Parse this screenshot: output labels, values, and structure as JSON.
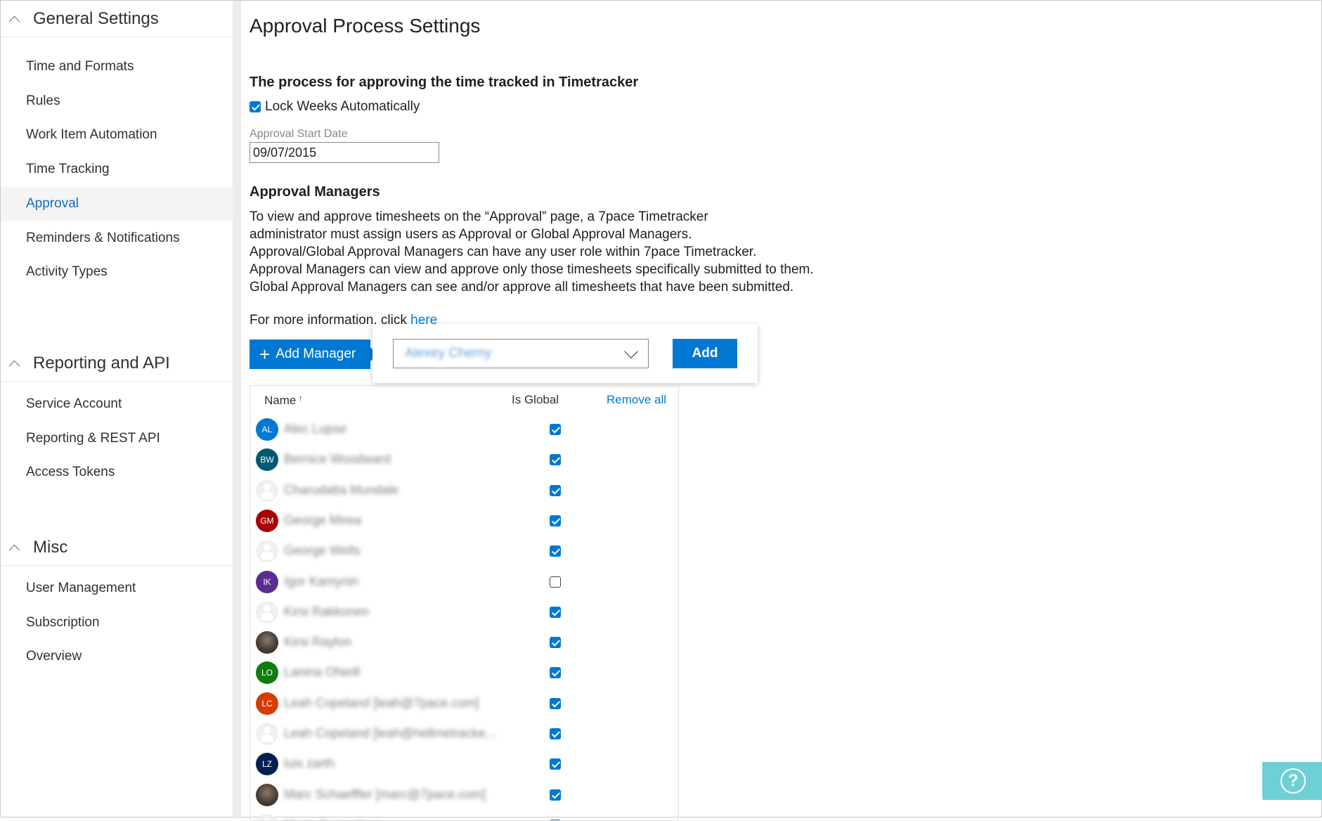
{
  "sidebar": {
    "sections": [
      {
        "title": "General Settings",
        "items": [
          {
            "label": "Time and Formats"
          },
          {
            "label": "Rules"
          },
          {
            "label": "Work Item Automation"
          },
          {
            "label": "Time Tracking"
          },
          {
            "label": "Approval",
            "active": true
          },
          {
            "label": "Reminders & Notifications"
          },
          {
            "label": "Activity Types"
          }
        ]
      },
      {
        "title": "Reporting and API",
        "items": [
          {
            "label": "Service Account"
          },
          {
            "label": "Reporting & REST API"
          },
          {
            "label": "Access Tokens"
          }
        ]
      },
      {
        "title": "Misc",
        "items": [
          {
            "label": "User Management"
          },
          {
            "label": "Subscription"
          },
          {
            "label": "Overview"
          }
        ]
      }
    ]
  },
  "main": {
    "title": "Approval Process Settings",
    "subtitle": "The process for approving the time tracked in Timetracker",
    "lock_weeks": {
      "label": "Lock Weeks Automatically",
      "checked": true
    },
    "approval_start_date": {
      "label": "Approval Start Date",
      "value": "09/07/2015"
    },
    "managers_title": "Approval Managers",
    "description": [
      "To view and approve timesheets on the “Approval” page, a 7pace Timetracker",
      "administrator must assign users as Approval or Global Approval Managers.",
      "Approval/Global Approval Managers can have any user role within 7pace Timetracker.",
      "Approval Managers can view and approve only those timesheets specifically submitted to them.",
      "Global Approval Managers can see and/or approve all timesheets that have been submitted."
    ],
    "more_info": {
      "text": "For more information, click",
      "link": "here"
    },
    "add_manager_label": "Add Manager",
    "popup": {
      "selected_user": "Alexey Cherny",
      "add_label": "Add"
    },
    "table": {
      "headers": {
        "name": "Name",
        "sort_icon": "↑",
        "is_global": "Is Global",
        "remove_all": "Remove all"
      },
      "rows": [
        {
          "initials": "AL",
          "color": "#0078d4",
          "name": "Alec Lupse",
          "global": true
        },
        {
          "initials": "BW",
          "color": "#005b70",
          "name": "Bernice Woodward",
          "global": true
        },
        {
          "initials": "",
          "avatar": "placeholder",
          "name": "Charudatta Mundale",
          "global": true
        },
        {
          "initials": "GM",
          "color": "#a80000",
          "name": "George Mirea",
          "global": true
        },
        {
          "initials": "",
          "avatar": "placeholder",
          "name": "George Wells",
          "global": true
        },
        {
          "initials": "IK",
          "color": "#5c2d91",
          "name": "Igor Kamynin",
          "global": false
        },
        {
          "initials": "",
          "avatar": "placeholder",
          "name": "Kirsi Rakkonen",
          "global": true
        },
        {
          "initials": "",
          "avatar": "photo",
          "name": "Kirsi Raylon",
          "global": true
        },
        {
          "initials": "LO",
          "color": "#107c10",
          "name": "Lanina ONeill",
          "global": true
        },
        {
          "initials": "LC",
          "color": "#d83b01",
          "name": "Leah Copeland [leah@7pace.com]",
          "global": true
        },
        {
          "initials": "",
          "avatar": "placeholder",
          "name": "Leah Copeland [leah@hellmetracke...",
          "global": true
        },
        {
          "initials": "LZ",
          "color": "#002050",
          "name": "luis zarth",
          "global": true
        },
        {
          "initials": "",
          "avatar": "photo",
          "name": "Marc Schaeffler [marc@7pace.com]",
          "global": true
        },
        {
          "initials": "",
          "avatar": "placeholder",
          "name": "Maria Samuelsen",
          "global": true
        }
      ]
    }
  },
  "help": {
    "icon": "help-question-icon",
    "glyph": "?"
  }
}
